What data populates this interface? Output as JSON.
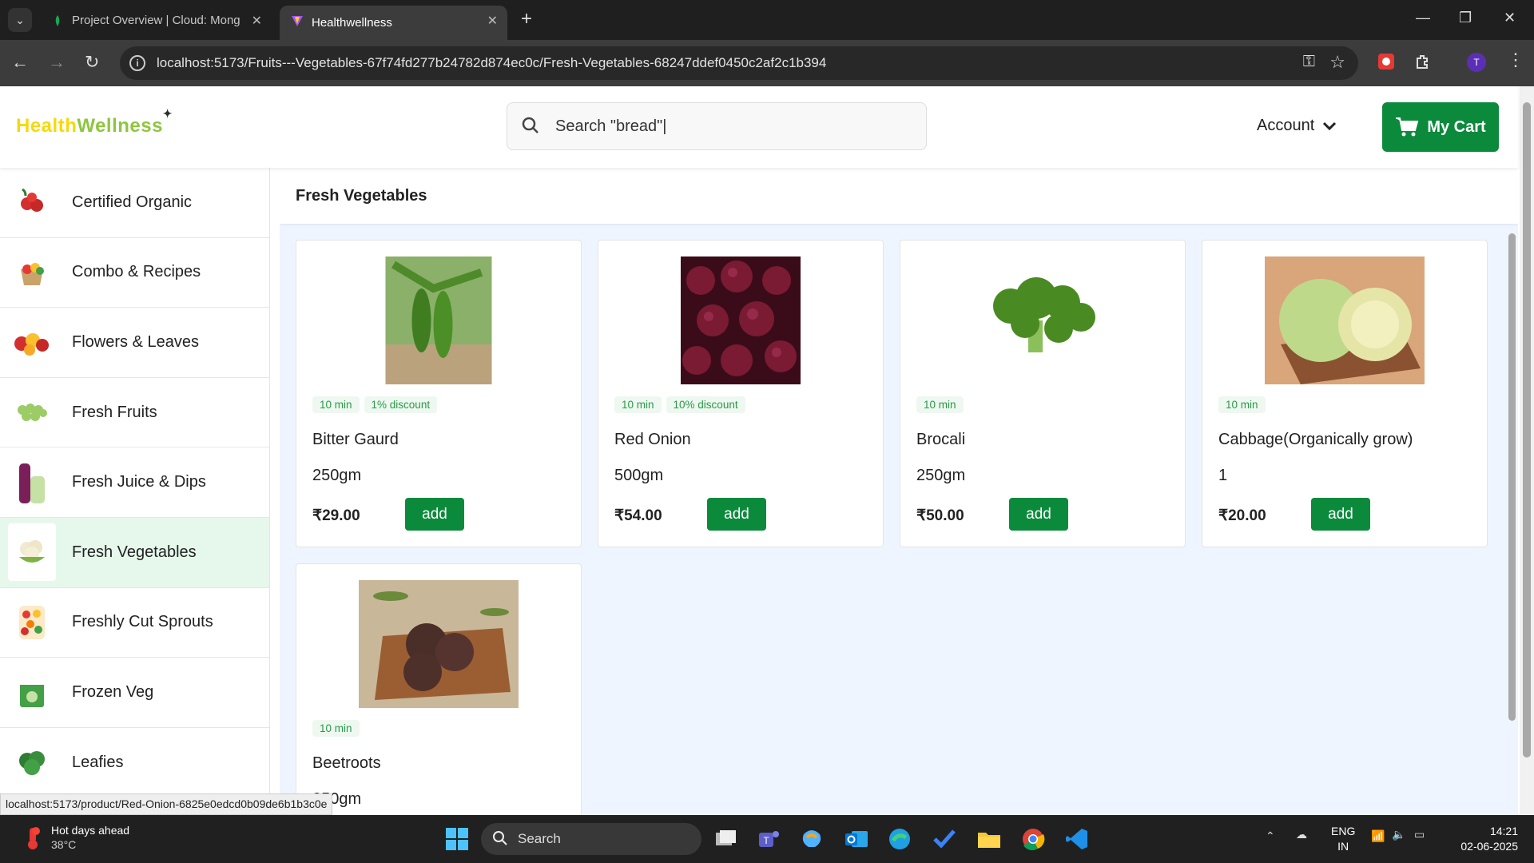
{
  "browser": {
    "tabs": [
      {
        "title": "Project Overview | Cloud: Mong"
      },
      {
        "title": "Healthwellness"
      }
    ],
    "url": "localhost:5173/Fruits---Vegetables-67f74fd277b24782d874ec0c/Fresh-Vegetables-68247ddef0450c2af2c1b394",
    "profile_initial": "T",
    "status_url": "localhost:5173/product/Red-Onion-6825e0edcd0b09de6b1b3c0e"
  },
  "header": {
    "logo_part1": "Health",
    "logo_part2": "Wellness",
    "search_placeholder": "Search \"bread\"|",
    "account_label": "Account",
    "cart_label": "My Cart"
  },
  "sidebar": {
    "items": [
      {
        "label": "Certified Organic"
      },
      {
        "label": "Combo & Recipes"
      },
      {
        "label": "Flowers & Leaves"
      },
      {
        "label": "Fresh Fruits"
      },
      {
        "label": "Fresh Juice & Dips"
      },
      {
        "label": "Fresh Vegetables",
        "active": true
      },
      {
        "label": "Freshly Cut Sprouts"
      },
      {
        "label": "Frozen Veg"
      },
      {
        "label": "Leafies"
      }
    ]
  },
  "main": {
    "title": "Fresh Vegetables",
    "products": [
      {
        "name": "Bitter Gaurd",
        "qty": "250gm",
        "price": "₹29.00",
        "time": "10 min",
        "discount": "1% discount",
        "add": "add"
      },
      {
        "name": "Red Onion",
        "qty": "500gm",
        "price": "₹54.00",
        "time": "10 min",
        "discount": "10% discount",
        "add": "add"
      },
      {
        "name": "Brocali",
        "qty": "250gm",
        "price": "₹50.00",
        "time": "10 min",
        "add": "add"
      },
      {
        "name": "Cabbage(Organically grow)",
        "qty": "1",
        "price": "₹20.00",
        "time": "10 min",
        "add": "add"
      },
      {
        "name": "Beetroots",
        "qty": "250gm",
        "time": "10 min"
      }
    ]
  },
  "taskbar": {
    "weather_title": "Hot days ahead",
    "weather_temp": "38°C",
    "search_label": "Search",
    "lang_line1": "ENG",
    "lang_line2": "IN",
    "time": "14:21",
    "date": "02-06-2025"
  },
  "colors": {
    "accent_green": "#0c8a3c",
    "active_category_bg": "#e6f8ec",
    "content_bg": "#eef5ff"
  }
}
